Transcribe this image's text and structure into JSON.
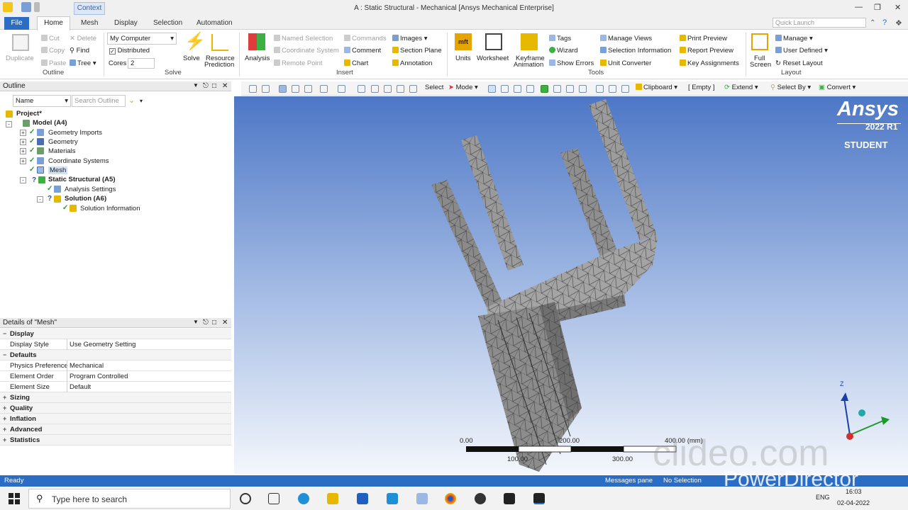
{
  "window": {
    "title": "A : Static Structural - Mechanical [Ansys Mechanical Enterprise]",
    "context_tab": "Context"
  },
  "ribbon_tabs": [
    "File",
    "Home",
    "Mesh",
    "Display",
    "Selection",
    "Automation"
  ],
  "quick_launch_placeholder": "Quick Launch",
  "ribbon": {
    "outline": {
      "duplicate": "Duplicate",
      "cut": "Cut",
      "delete": "Delete",
      "copy": "Copy",
      "find": "Find",
      "paste": "Paste",
      "tree": "Tree",
      "label": "Outline"
    },
    "solve": {
      "computer": "My Computer",
      "distributed": "Distributed",
      "cores_label": "Cores",
      "cores_value": "2",
      "solve": "Solve",
      "resource1": "Resource",
      "resource2": "Prediction",
      "label": "Solve"
    },
    "insert": {
      "analysis": "Analysis",
      "named_selection": "Named Selection",
      "coordinate_system": "Coordinate System",
      "remote_point": "Remote Point",
      "commands": "Commands",
      "comment": "Comment",
      "chart": "Chart",
      "images": "Images",
      "section_plane": "Section Plane",
      "annotation": "Annotation",
      "label": "Insert"
    },
    "tools": {
      "units": "Units",
      "worksheet": "Worksheet",
      "keyframe1": "Keyframe",
      "keyframe2": "Animation",
      "tags": "Tags",
      "wizard": "Wizard",
      "show_errors": "Show Errors",
      "manage_views": "Manage Views",
      "selection_information": "Selection Information",
      "unit_converter": "Unit Converter",
      "print_preview": "Print Preview",
      "report_preview": "Report Preview",
      "key_assignments": "Key Assignments",
      "label": "Tools"
    },
    "layout": {
      "full1": "Full",
      "full2": "Screen",
      "manage": "Manage",
      "user_defined": "User Defined",
      "reset_layout": "Reset Layout",
      "label": "Layout"
    }
  },
  "outline_panel": {
    "title": "Outline",
    "name_filter": "Name",
    "search_placeholder": "Search Outline"
  },
  "tree": [
    "Project*",
    "Model (A4)",
    "Geometry Imports",
    "Geometry",
    "Materials",
    "Coordinate Systems",
    "Mesh",
    "Static Structural (A5)",
    "Analysis Settings",
    "Solution (A6)",
    "Solution Information"
  ],
  "details_panel": {
    "title": "Details of \"Mesh\"",
    "rows": [
      {
        "k": "Display",
        "sec": true
      },
      {
        "k": "Display Style",
        "v": "Use Geometry Setting"
      },
      {
        "k": "Defaults",
        "sec": true
      },
      {
        "k": "Physics Preference",
        "v": "Mechanical"
      },
      {
        "k": "Element Order",
        "v": "Program Controlled"
      },
      {
        "k": "Element Size",
        "v": "Default"
      },
      {
        "k": "Sizing",
        "sec": true
      },
      {
        "k": "Quality",
        "sec": true
      },
      {
        "k": "Inflation",
        "sec": true
      },
      {
        "k": "Advanced",
        "sec": true
      },
      {
        "k": "Statistics",
        "sec": true
      }
    ]
  },
  "graphics_toolbar": {
    "select": "Select",
    "mode": "Mode",
    "clipboard": "Clipboard",
    "empty": "[ Empty ]",
    "extend": "Extend",
    "select_by": "Select By",
    "convert": "Convert"
  },
  "branding": {
    "name": "Ansys",
    "version": "2022 R1",
    "edition": "STUDENT"
  },
  "scale": {
    "t0": "0.00",
    "t200": "200.00",
    "t400": "400.00 (mm)",
    "t100": "100.00",
    "t300": "300.00"
  },
  "triad": {
    "z": "Z"
  },
  "status": {
    "ready": "Ready",
    "messages": "Messages pane",
    "selection": "No Selection"
  },
  "taskbar": {
    "search": "Type here to search",
    "time": "16:03",
    "date": "02-04-2022",
    "lang": "ENG"
  },
  "watermark": {
    "clideo": "clideo.com",
    "powerdirector": "PowerDirector"
  },
  "colors": {
    "accent": "#2b6cc4",
    "viewport_top": "#4d77c6",
    "viewport_bottom": "#f4f7fc"
  }
}
